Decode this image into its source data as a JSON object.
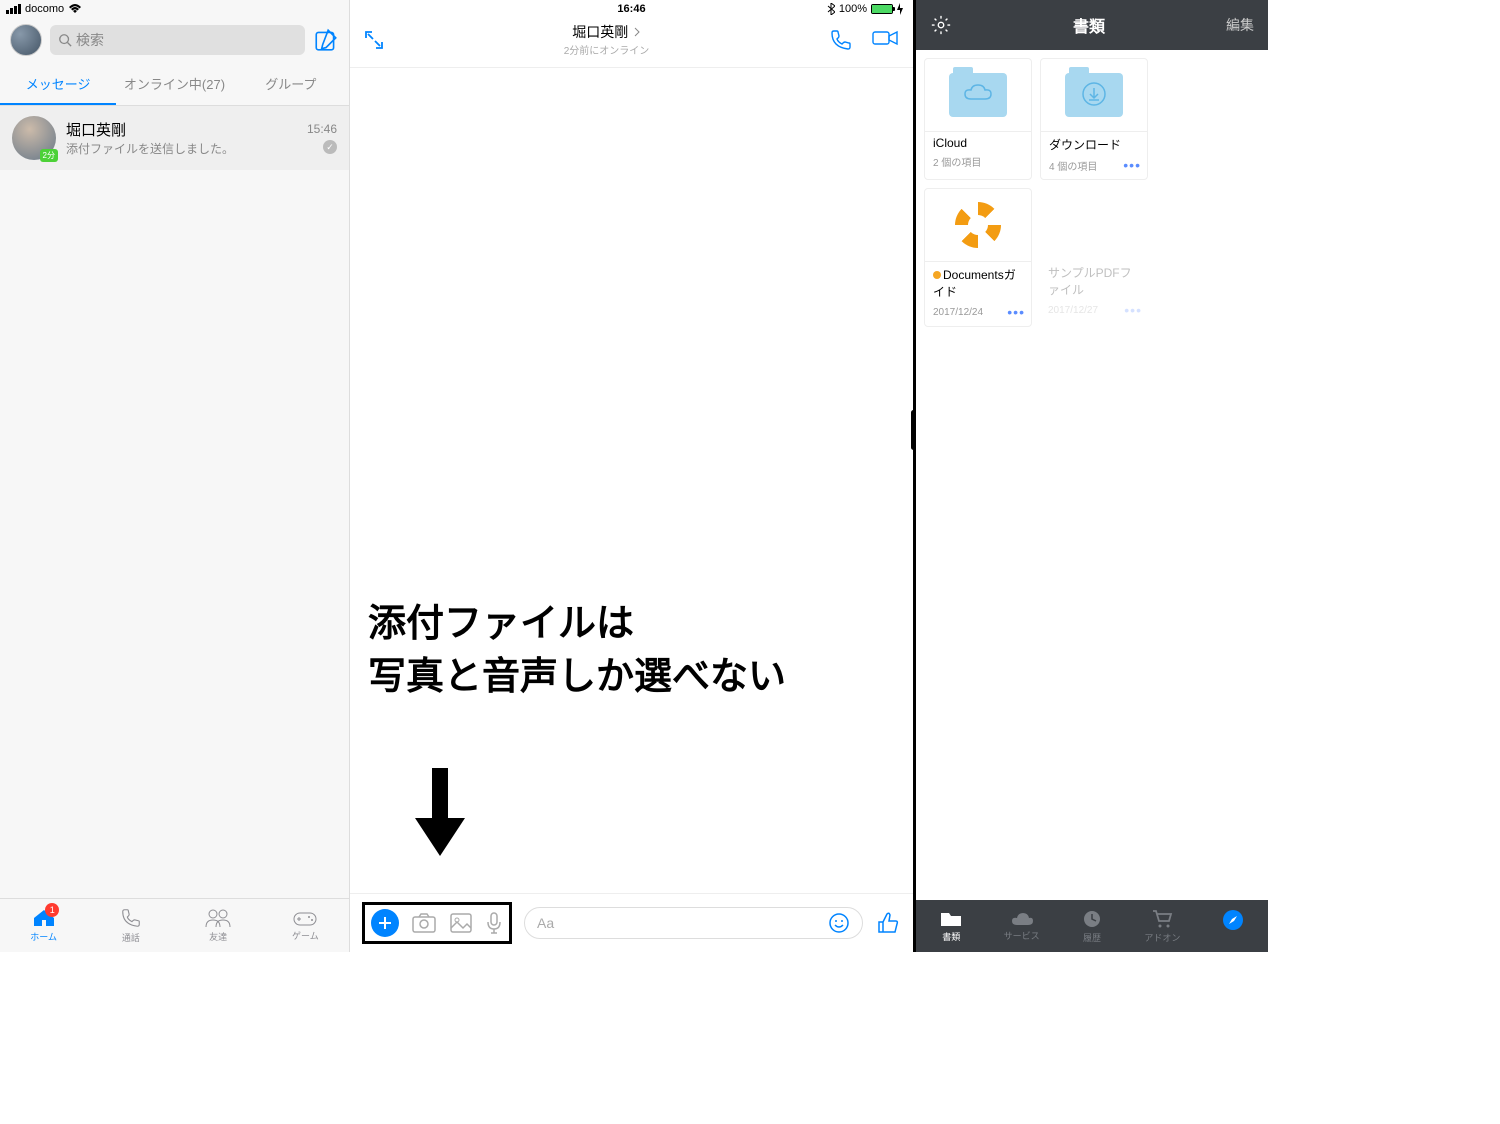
{
  "status": {
    "carrier": "docomo",
    "time": "16:46",
    "battery_pct": "100%"
  },
  "left": {
    "search_placeholder": "検索",
    "tabs": {
      "messages": "メッセージ",
      "online": "オンライン中(27)",
      "groups": "グループ"
    },
    "convo": {
      "name": "堀口英剛",
      "sub": "添付ファイルを送信しました。",
      "time": "15:46",
      "badge": "2分"
    },
    "bottom": {
      "home": "ホーム",
      "calls": "通話",
      "friends": "友達",
      "games": "ゲーム",
      "badge": "1"
    }
  },
  "chat": {
    "title": "堀口英剛",
    "subtitle": "2分前にオンライン",
    "input_placeholder": "Aa",
    "annotation_l1": "添付ファイルは",
    "annotation_l2": "写真と音声しか選べない"
  },
  "docs": {
    "header_title": "書類",
    "edit": "編集",
    "items": [
      {
        "name": "iCloud",
        "meta": "2 個の項目"
      },
      {
        "name": "ダウンロード",
        "meta": "4 個の項目"
      },
      {
        "name": "Documentsガイド",
        "meta": "2017/12/24"
      },
      {
        "name": "サンプルPDFファイル",
        "meta": "2017/12/27"
      }
    ],
    "tabs": {
      "docs": "書類",
      "service": "サービス",
      "history": "履歴",
      "addon": "アドオン"
    }
  }
}
